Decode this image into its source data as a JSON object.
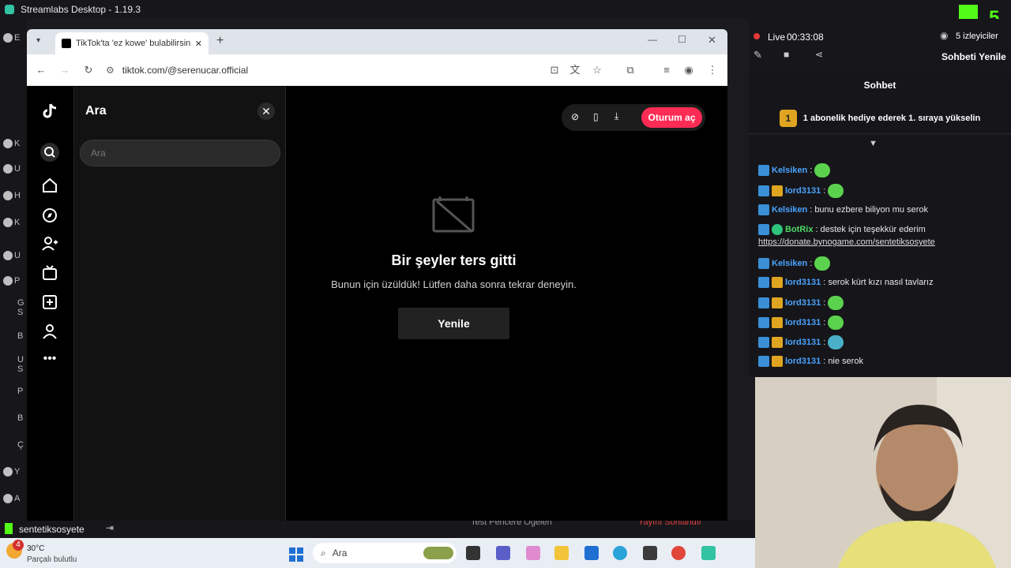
{
  "app": {
    "title": "Streamlabs Desktop - 1.19.3"
  },
  "left_nav": {
    "items": [
      "E",
      "K",
      "U",
      "H",
      "K",
      "U",
      "P",
      "G\nS",
      "B",
      "U\nS",
      "P",
      "B",
      "Ç",
      "Y",
      "A"
    ]
  },
  "bottom_bar": {
    "account": "sentetiksosyete",
    "test_label": "Test Pencere Ögeleri",
    "end_stream": "Yayını Sonlandır"
  },
  "browser": {
    "tab_title": "TikTok'ta 'ez kowe' bulabilirsiniz",
    "new_tab": "+",
    "url": "tiktok.com/@serenucar.official"
  },
  "tiktok": {
    "search": {
      "title": "Ara",
      "placeholder": "Ara",
      "value": ""
    },
    "login_button": "Oturum aç",
    "error": {
      "title": "Bir şeyler ters gitti",
      "subtitle": "Bunun için üzüldük! Lütfen daha sonra tekrar deneyin.",
      "button": "Yenile"
    }
  },
  "chat": {
    "live_label": "Live",
    "live_time": "00:33:08",
    "viewers": "5 izleyiciler",
    "refresh_chat": "Sohbeti Yenile",
    "title": "Sohbet",
    "gift_rank": "1",
    "gift_text": "1 abonelik hediye ederek 1. sıraya yükselin",
    "messages": [
      {
        "user": "Kelsiken",
        "sep": ":",
        "text": ""
      },
      {
        "user": "lord3131",
        "sep": ":",
        "text": ""
      },
      {
        "user": "Kelsiken",
        "sep": ":",
        "text": " bunu ezbere biliyon mu serok"
      },
      {
        "user": "BotRix",
        "sep": ":",
        "text": " destek için teşekkür ederim"
      },
      {
        "user": "Kelsiken",
        "sep": ":",
        "text": ""
      },
      {
        "user": "lord3131",
        "sep": ":",
        "text": " serok kürt kızı nasıl tavlarız"
      },
      {
        "user": "lord3131",
        "sep": ":",
        "text": ""
      },
      {
        "user": "lord3131",
        "sep": ":",
        "text": ""
      },
      {
        "user": "lord3131",
        "sep": ":",
        "text": ""
      },
      {
        "user": "lord3131",
        "sep": ":",
        "text": " nie serok"
      }
    ],
    "bot_link": "https://donate.bynogame.com/sentetiksosyete"
  },
  "taskbar": {
    "weather_temp": "30°C",
    "weather_desc": "Parçalı bulutlu",
    "weather_badge": "4",
    "search_placeholder": "Ara"
  },
  "colors": {
    "tiktok_red": "#fe2c55",
    "chat_user": "#4aa3ff",
    "bot_green": "#4cd964",
    "live_dot": "#e53935"
  }
}
